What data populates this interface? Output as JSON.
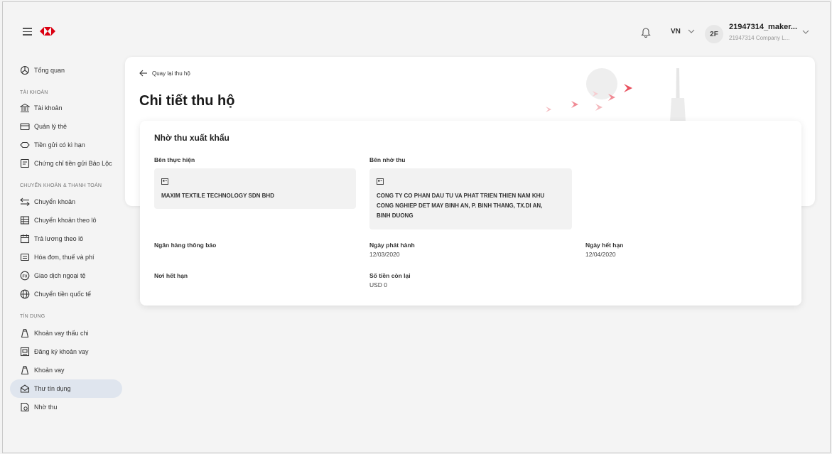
{
  "header": {
    "language": "VN",
    "avatar_initials": "2F",
    "user_name": "21947314_maker...",
    "company": "21947314 Company L..."
  },
  "sidebar": {
    "items": [
      {
        "label": "Tổng quan",
        "icon": "dashboard-icon"
      },
      {
        "label": "Tài khoản",
        "icon": "bank-icon"
      },
      {
        "label": "Quản lý thẻ",
        "icon": "card-icon"
      },
      {
        "label": "Tiền gửi có kì hạn",
        "icon": "deposit-icon"
      },
      {
        "label": "Chứng chỉ tiền gửi Bảo Lộc",
        "icon": "certificate-icon"
      },
      {
        "label": "Chuyển khoản",
        "icon": "transfer-icon"
      },
      {
        "label": "Chuyển khoản theo lô",
        "icon": "batch-transfer-icon"
      },
      {
        "label": "Trả lương theo lô",
        "icon": "calendar-icon"
      },
      {
        "label": "Hóa đơn, thuế và phí",
        "icon": "bill-icon"
      },
      {
        "label": "Giao dịch ngoại tệ",
        "icon": "fx-icon"
      },
      {
        "label": "Chuyển tiền quốc tế",
        "icon": "globe-icon"
      },
      {
        "label": "Khoản vay thấu chi",
        "icon": "money-bag-icon"
      },
      {
        "label": "Đăng ký khoản vay",
        "icon": "loan-register-icon"
      },
      {
        "label": "Khoản vay",
        "icon": "loan-icon"
      },
      {
        "label": "Thư tín dụng",
        "icon": "letter-of-credit-icon"
      },
      {
        "label": "Nhờ thu",
        "icon": "collection-icon"
      }
    ],
    "sections": {
      "accounts": "TÀI KHOẢN",
      "transfer": "CHUYỂN KHOẢN & THANH TOÁN",
      "credit": "TÍN DỤNG"
    },
    "active_index": 14
  },
  "page": {
    "back_label": "Quay lại thu hộ",
    "title": "Chi tiết thu hộ"
  },
  "detail": {
    "section_title": "Nhờ thu xuất khẩu",
    "performer_label": "Bên thực hiện",
    "performer_name": "MAXIM TEXTILE TECHNOLOGY SDN BHD",
    "collector_label": "Bên nhờ thu",
    "collector_name_line1": "CONG TY CO PHAN DAU TU VA PHAT TRIEN THIEN NAM KHU",
    "collector_name_line2": "CONG NGHIEP DET MAY BINH AN, P. BINH THANG, TX.DI AN,",
    "collector_name_line3": "BINH DUONG",
    "advising_bank_label": "Ngân hàng thông báo",
    "issue_date_label": "Ngày phát hành",
    "issue_date": "12/03/2020",
    "expiry_date_label": "Ngày hết hạn",
    "expiry_date": "12/04/2020",
    "expiry_place_label": "Nơi hết hạn",
    "remaining_label": "Số tiền còn lại",
    "remaining_value": "USD 0"
  },
  "colors": {
    "brand_red": "#db0011",
    "active_nav": "#dfe5ee",
    "deco_pink": "#f08a94"
  }
}
